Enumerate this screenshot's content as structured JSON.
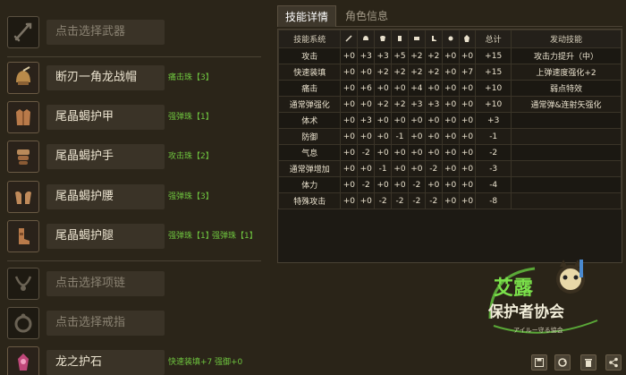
{
  "weapon": {
    "placeholder": "点击选择武器",
    "icon": "sword-icon"
  },
  "armor": [
    {
      "name": "断刃一角龙战帽",
      "icon": "helm-icon",
      "decos": [
        "痛击珠【3】"
      ]
    },
    {
      "name": "尾晶蝎护甲",
      "icon": "chest-icon",
      "decos": [
        "强弹珠【1】"
      ]
    },
    {
      "name": "尾晶蝎护手",
      "icon": "arms-icon",
      "decos": [
        "攻击珠【2】"
      ]
    },
    {
      "name": "尾晶蝎护腰",
      "icon": "waist-icon",
      "decos": [
        "强弹珠【3】"
      ]
    },
    {
      "name": "尾晶蝎护腿",
      "icon": "legs-icon",
      "decos": [
        "强弹珠【1】",
        "强弹珠【1】"
      ]
    }
  ],
  "necklace": {
    "placeholder": "点击选择项链",
    "icon": "necklace-icon"
  },
  "ring": {
    "placeholder": "点击选择戒指",
    "icon": "ring-icon"
  },
  "charm": {
    "name": "龙之护石",
    "icon": "charm-icon",
    "decos": [
      "快速装填+7",
      "强御+0"
    ]
  },
  "tabs": [
    {
      "label": "技能详情",
      "active": true
    },
    {
      "label": "角色信息",
      "active": false
    }
  ],
  "table": {
    "header_name": "技能系统",
    "header_icons": [
      "weapon-icon",
      "helm-icon",
      "chest-icon",
      "arms-icon",
      "waist-icon",
      "legs-icon",
      "deco-icon",
      "charm-icon"
    ],
    "header_total": "总计",
    "header_active": "发动技能",
    "rows": [
      {
        "name": "攻击",
        "vals": [
          "+0",
          "+3",
          "+3",
          "+5",
          "+2",
          "+2",
          "+0",
          "+0"
        ],
        "total": "+15",
        "active": "攻击力提升（中）"
      },
      {
        "name": "快速装填",
        "vals": [
          "+0",
          "+0",
          "+2",
          "+2",
          "+2",
          "+2",
          "+0",
          "+7"
        ],
        "total": "+15",
        "active": "上弹速度强化+2"
      },
      {
        "name": "痛击",
        "vals": [
          "+0",
          "+6",
          "+0",
          "+0",
          "+4",
          "+0",
          "+0",
          "+0"
        ],
        "total": "+10",
        "active": "弱点特效"
      },
      {
        "name": "通常弹强化",
        "vals": [
          "+0",
          "+0",
          "+2",
          "+2",
          "+3",
          "+3",
          "+0",
          "+0"
        ],
        "total": "+10",
        "active": "通常弹&连射矢强化"
      },
      {
        "name": "体术",
        "vals": [
          "+0",
          "+3",
          "+0",
          "+0",
          "+0",
          "+0",
          "+0",
          "+0"
        ],
        "total": "+3",
        "active": ""
      },
      {
        "name": "防御",
        "vals": [
          "+0",
          "+0",
          "+0",
          "-1",
          "+0",
          "+0",
          "+0",
          "+0"
        ],
        "total": "-1",
        "active": ""
      },
      {
        "name": "气息",
        "vals": [
          "+0",
          "-2",
          "+0",
          "+0",
          "+0",
          "+0",
          "+0",
          "+0"
        ],
        "total": "-2",
        "active": ""
      },
      {
        "name": "通常弹增加",
        "vals": [
          "+0",
          "+0",
          "-1",
          "+0",
          "+0",
          "-2",
          "+0",
          "+0"
        ],
        "total": "-3",
        "active": ""
      },
      {
        "name": "体力",
        "vals": [
          "+0",
          "-2",
          "+0",
          "+0",
          "-2",
          "+0",
          "+0",
          "+0"
        ],
        "total": "-4",
        "active": ""
      },
      {
        "name": "特殊攻击",
        "vals": [
          "+0",
          "+0",
          "-2",
          "-2",
          "-2",
          "-2",
          "+0",
          "+0"
        ],
        "total": "-8",
        "active": ""
      }
    ]
  },
  "logo": {
    "line1": "艾露",
    "line2": "保护者协会",
    "line3": "アイルー守る協会"
  },
  "buttons": [
    {
      "name": "save-button",
      "icon": "save-icon"
    },
    {
      "name": "refresh-button",
      "icon": "refresh-icon"
    },
    {
      "name": "delete-button",
      "icon": "trash-icon"
    },
    {
      "name": "share-button",
      "icon": "share-icon"
    }
  ]
}
